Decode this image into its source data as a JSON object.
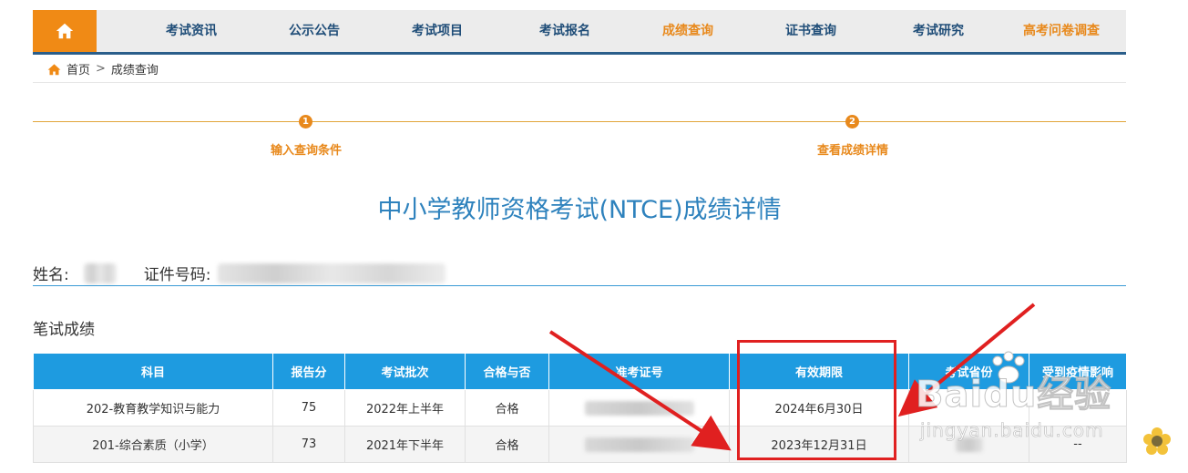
{
  "nav": {
    "items": [
      {
        "label": "考试资讯",
        "accent": false
      },
      {
        "label": "公示公告",
        "accent": false
      },
      {
        "label": "考试项目",
        "accent": false
      },
      {
        "label": "考试报名",
        "accent": false
      },
      {
        "label": "成绩查询",
        "accent": true
      },
      {
        "label": "证书查询",
        "accent": false
      },
      {
        "label": "考试研究",
        "accent": false
      },
      {
        "label": "高考问卷调查",
        "accent": true
      }
    ],
    "home_icon": "home-icon"
  },
  "breadcrumb": {
    "home": "首页",
    "separator": ">",
    "current": "成绩查询"
  },
  "steps": [
    {
      "num": "1",
      "label": "输入查询条件"
    },
    {
      "num": "2",
      "label": "查看成绩详情"
    }
  ],
  "page_title": "中小学教师资格考试(NTCE)成绩详情",
  "info": {
    "name_label": "姓名:",
    "id_label": "证件号码:"
  },
  "section_title": "笔试成绩",
  "table": {
    "headers": [
      "科目",
      "报告分",
      "考试批次",
      "合格与否",
      "准考证号",
      "有效期限",
      "考试省份",
      "受到疫情影响"
    ],
    "rows": [
      {
        "subject": "202-教育教学知识与能力",
        "score": "75",
        "batch": "2022年上半年",
        "pass": "合格",
        "valid": "2024年6月30日",
        "covid": ""
      },
      {
        "subject": "201-综合素质（小学）",
        "score": "73",
        "batch": "2021年下半年",
        "pass": "合格",
        "valid": "2023年12月31日",
        "covid": "--"
      }
    ]
  },
  "watermark": {
    "brand": "Baidu经验",
    "url": "jingyan.baidu.com"
  },
  "colors": {
    "nav_accent": "#e8891c",
    "nav_text": "#1f4d78",
    "table_header": "#1e9be0",
    "title": "#2e82bd",
    "annotation": "#e02020"
  }
}
